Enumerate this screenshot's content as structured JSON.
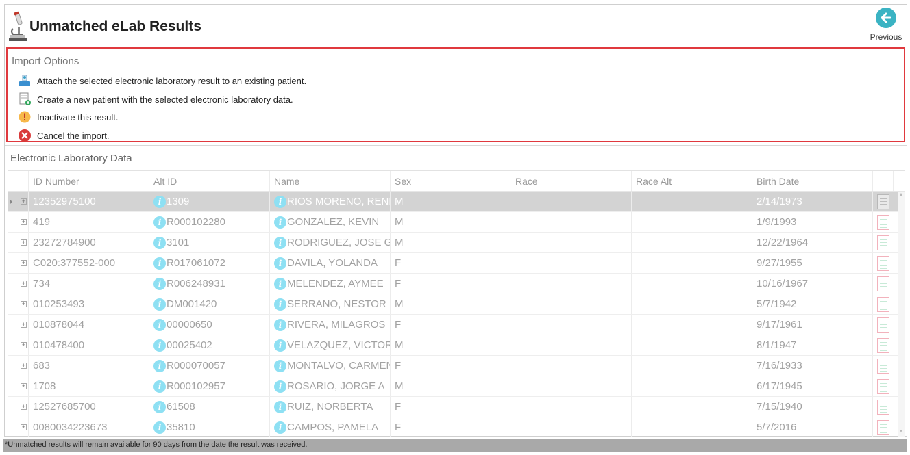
{
  "header": {
    "title": "Unmatched eLab Results",
    "previous_label": "Previous"
  },
  "import_options": {
    "title": "Import Options",
    "options": [
      {
        "label": "Attach the selected electronic laboratory result to an existing patient.",
        "icon": "attach-patient-icon"
      },
      {
        "label": "Create a new patient with the selected electronic laboratory data.",
        "icon": "new-patient-icon"
      },
      {
        "label": "Inactivate this result.",
        "icon": "warning-icon"
      },
      {
        "label": "Cancel the import.",
        "icon": "cancel-icon"
      }
    ]
  },
  "grid": {
    "title": "Electronic Laboratory Data",
    "columns": [
      "ID Number",
      "Alt ID",
      "Name",
      "Sex",
      "Race",
      "Race Alt",
      "Birth Date"
    ],
    "rows": [
      {
        "id": "12352975100",
        "alt_id": "1309",
        "name": "RIOS MORENO, RENE",
        "sex": "M",
        "race": "",
        "race_alt": "",
        "birth": "2/14/1973",
        "selected": true
      },
      {
        "id": "419",
        "alt_id": "R000102280",
        "name": "GONZALEZ, KEVIN",
        "sex": "M",
        "race": "",
        "race_alt": "",
        "birth": "1/9/1993"
      },
      {
        "id": "23272784900",
        "alt_id": "3101",
        "name": "RODRIGUEZ, JOSE G",
        "sex": "M",
        "race": "",
        "race_alt": "",
        "birth": "12/22/1964"
      },
      {
        "id": "C020:377552-000",
        "alt_id": "R017061072",
        "name": "DAVILA, YOLANDA",
        "sex": "F",
        "race": "",
        "race_alt": "",
        "birth": "9/27/1955"
      },
      {
        "id": "734",
        "alt_id": "R006248931",
        "name": "MELENDEZ, AYMEE",
        "sex": "F",
        "race": "",
        "race_alt": "",
        "birth": "10/16/1967"
      },
      {
        "id": "010253493",
        "alt_id": "DM001420",
        "name": "SERRANO, NESTOR",
        "sex": "M",
        "race": "",
        "race_alt": "",
        "birth": "5/7/1942"
      },
      {
        "id": "010878044",
        "alt_id": "00000650",
        "name": "RIVERA, MILAGROS",
        "sex": "F",
        "race": "",
        "race_alt": "",
        "birth": "9/17/1961"
      },
      {
        "id": "010478400",
        "alt_id": "00025402",
        "name": "VELAZQUEZ, VICTOR I",
        "sex": "M",
        "race": "",
        "race_alt": "",
        "birth": "8/1/1947"
      },
      {
        "id": "683",
        "alt_id": "R000070057",
        "name": "MONTALVO, CARMEN",
        "sex": "F",
        "race": "",
        "race_alt": "",
        "birth": "7/16/1933"
      },
      {
        "id": "1708",
        "alt_id": "R000102957",
        "name": "ROSARIO, JORGE A",
        "sex": "M",
        "race": "",
        "race_alt": "",
        "birth": "6/17/1945"
      },
      {
        "id": "12527685700",
        "alt_id": "61508",
        "name": "RUIZ, NORBERTA",
        "sex": "F",
        "race": "",
        "race_alt": "",
        "birth": "7/15/1940"
      },
      {
        "id": "0080034223673",
        "alt_id": "35810",
        "name": "CAMPOS, PAMELA",
        "sex": "F",
        "race": "",
        "race_alt": "",
        "birth": "5/7/2016"
      }
    ]
  },
  "footer": {
    "note": "*Unmatched results will remain available for 90 days from the date the result was received."
  }
}
